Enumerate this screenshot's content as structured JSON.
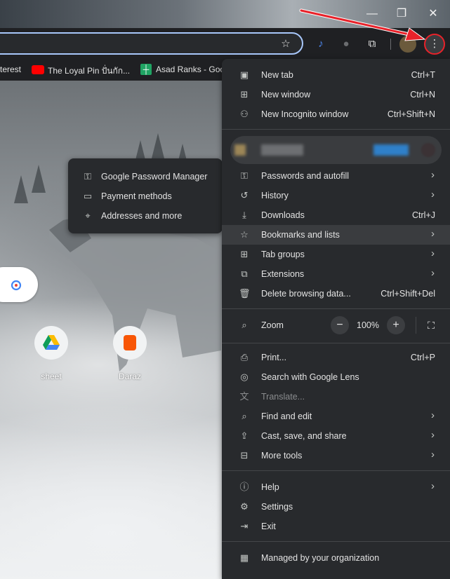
{
  "window": {
    "minimize": "—",
    "restore": "❐",
    "close": "✕"
  },
  "bookmarks": [
    {
      "label": "terest"
    },
    {
      "label": "The Loyal Pin ปั่นกัก..."
    },
    {
      "label": "Asad Ranks - Goo"
    }
  ],
  "shortcuts": [
    {
      "label": "sheet"
    },
    {
      "label": "Daraz"
    }
  ],
  "menu": {
    "new_tab": {
      "label": "New tab",
      "shortcut": "Ctrl+T"
    },
    "new_window": {
      "label": "New window",
      "shortcut": "Ctrl+N"
    },
    "new_incognito": {
      "label": "New Incognito window",
      "shortcut": "Ctrl+Shift+N"
    },
    "passwords": {
      "label": "Passwords and autofill"
    },
    "history": {
      "label": "History"
    },
    "downloads": {
      "label": "Downloads",
      "shortcut": "Ctrl+J"
    },
    "bookmarks": {
      "label": "Bookmarks and lists"
    },
    "tab_groups": {
      "label": "Tab groups"
    },
    "extensions": {
      "label": "Extensions"
    },
    "delete_data": {
      "label": "Delete browsing data...",
      "shortcut": "Ctrl+Shift+Del"
    },
    "zoom": {
      "label": "Zoom",
      "level": "100%",
      "minus": "−",
      "plus": "+"
    },
    "print": {
      "label": "Print...",
      "shortcut": "Ctrl+P"
    },
    "lens": {
      "label": "Search with Google Lens"
    },
    "translate": {
      "label": "Translate..."
    },
    "find_edit": {
      "label": "Find and edit"
    },
    "cast_save": {
      "label": "Cast, save, and share"
    },
    "more_tools": {
      "label": "More tools"
    },
    "help": {
      "label": "Help"
    },
    "settings": {
      "label": "Settings"
    },
    "exit": {
      "label": "Exit"
    },
    "managed": {
      "label": "Managed by your organization"
    }
  },
  "submenu": {
    "password_manager": {
      "label": "Google Password Manager"
    },
    "payment": {
      "label": "Payment methods"
    },
    "addresses": {
      "label": "Addresses and more"
    }
  },
  "colors": {
    "menu_bg": "#282a2d",
    "accent": "#a8c7fa",
    "annotation": "#e8222a"
  }
}
